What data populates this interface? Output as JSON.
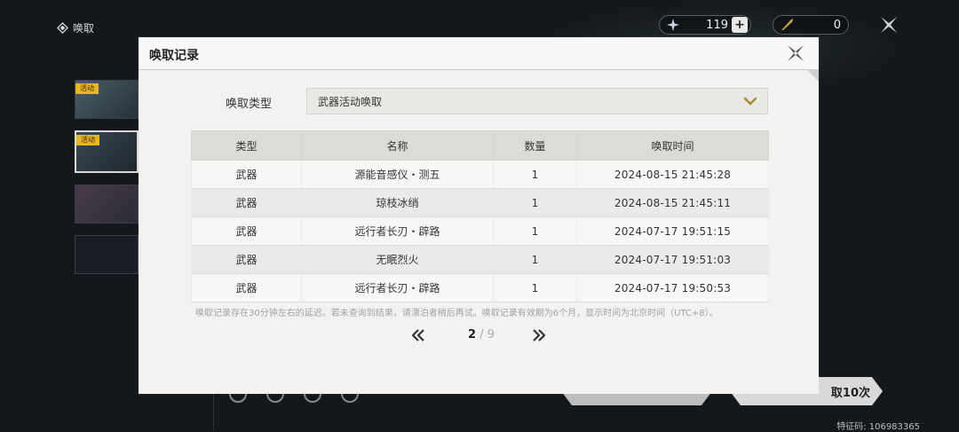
{
  "page": {
    "title": "唤取",
    "feature_code": "特征码: 106983365"
  },
  "currencies": [
    {
      "icon": "star-currency-icon",
      "value": "119",
      "has_plus": true
    },
    {
      "icon": "feather-currency-icon",
      "value": "0",
      "has_plus": false
    }
  ],
  "sidebar": {
    "tags": [
      "活动",
      "活动"
    ]
  },
  "buttons": {
    "pull_ten": "取10次"
  },
  "modal": {
    "title": "唤取记录",
    "type_label": "唤取类型",
    "selected_type": "武器活动唤取",
    "table": {
      "columns": [
        "类型",
        "名称",
        "数量",
        "唤取时间"
      ],
      "rows": [
        {
          "type": "武器",
          "name": "源能音感仪・测五",
          "count": "1",
          "time": "2024-08-15 21:45:28",
          "rarity": "normal"
        },
        {
          "type": "武器",
          "name": "琼枝冰绡",
          "count": "1",
          "time": "2024-08-15 21:45:11",
          "rarity": "gold"
        },
        {
          "type": "武器",
          "name": "远行者长刃・辟路",
          "count": "1",
          "time": "2024-07-17 19:51:15",
          "rarity": "normal"
        },
        {
          "type": "武器",
          "name": "无眠烈火",
          "count": "1",
          "time": "2024-07-17 19:51:03",
          "rarity": "purple"
        },
        {
          "type": "武器",
          "name": "远行者长刃・辟路",
          "count": "1",
          "time": "2024-07-17 19:50:53",
          "rarity": "normal"
        }
      ]
    },
    "notice": "唤取记录存在30分钟左右的延迟。若未查询到结果，请漂泊者稍后再试。唤取记录有效期为6个月，显示时间为北京时间（UTC+8）。",
    "pagination": {
      "current": "2",
      "separator": "/",
      "total": "9"
    }
  },
  "colors": {
    "gold_rarity": "#d4a21c",
    "purple_rarity": "#9a6dbf",
    "tag_yellow": "#e8b428"
  }
}
